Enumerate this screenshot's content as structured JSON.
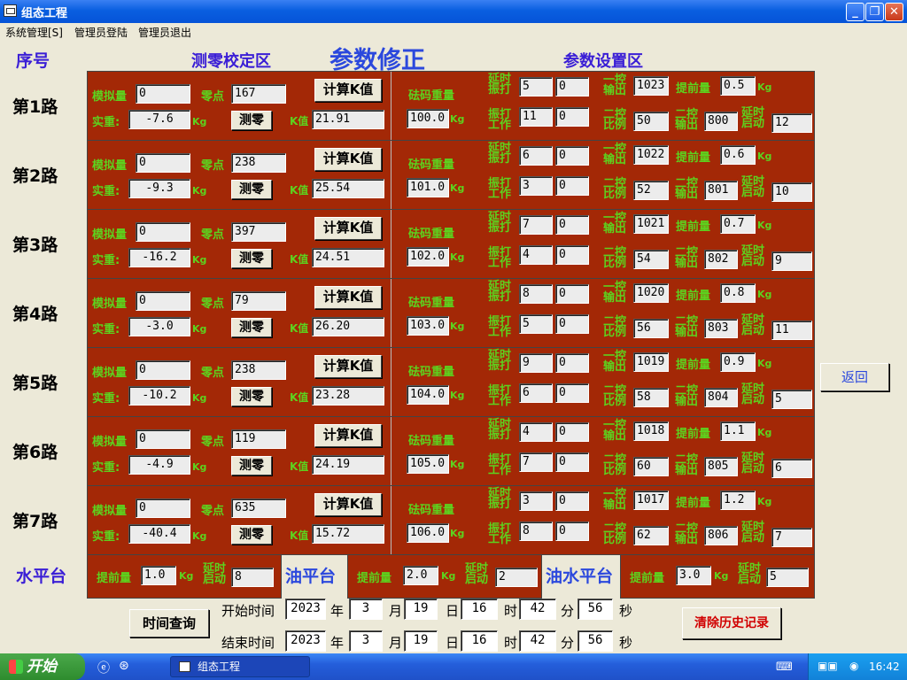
{
  "window": {
    "title": "组态工程"
  },
  "menu": [
    "系统管理[S]",
    "管理员登陆",
    "管理员退出"
  ],
  "header": {
    "seq": "序号",
    "calib": "测零校定区",
    "main": "参数修正",
    "params": "参数设置区"
  },
  "labels": {
    "analog": "模拟量",
    "zero": "零点",
    "weight": "实重:",
    "calc_k": "计算K值",
    "tare": "测零",
    "k_value": "K值",
    "weight_std": "砝码重量",
    "delay_vib_1": "延时",
    "delay_vib_2": "振打",
    "vib_work_1": "振打",
    "vib_work_2": "工作",
    "ctrl1_out_1": "一控",
    "ctrl1_out_2": "输出",
    "advance": "提前量",
    "ctrl2_ratio_1": "二控",
    "ctrl2_ratio_2": "比例",
    "ctrl2_out_1": "二控",
    "ctrl2_out_2": "输出",
    "delay_start_1": "延时",
    "delay_start_2": "启动",
    "kg": "Kg"
  },
  "rows": [
    {
      "name": "第1路",
      "analog": "0",
      "zero": "167",
      "weight": "-7.6",
      "k": "21.91",
      "std": "100.0",
      "dv1": "5",
      "dv2": "0",
      "vw1": "11",
      "vw2": "0",
      "c1out": "1023",
      "adv": "0.5",
      "c2ratio": "50",
      "c2out": "800",
      "dstart": "12"
    },
    {
      "name": "第2路",
      "analog": "0",
      "zero": "238",
      "weight": "-9.3",
      "k": "25.54",
      "std": "101.0",
      "dv1": "6",
      "dv2": "0",
      "vw1": "3",
      "vw2": "0",
      "c1out": "1022",
      "adv": "0.6",
      "c2ratio": "52",
      "c2out": "801",
      "dstart": "10"
    },
    {
      "name": "第3路",
      "analog": "0",
      "zero": "397",
      "weight": "-16.2",
      "k": "24.51",
      "std": "102.0",
      "dv1": "7",
      "dv2": "0",
      "vw1": "4",
      "vw2": "0",
      "c1out": "1021",
      "adv": "0.7",
      "c2ratio": "54",
      "c2out": "802",
      "dstart": "9"
    },
    {
      "name": "第4路",
      "analog": "0",
      "zero": "79",
      "weight": "-3.0",
      "k": "26.20",
      "std": "103.0",
      "dv1": "8",
      "dv2": "0",
      "vw1": "5",
      "vw2": "0",
      "c1out": "1020",
      "adv": "0.8",
      "c2ratio": "56",
      "c2out": "803",
      "dstart": "11"
    },
    {
      "name": "第5路",
      "analog": "0",
      "zero": "238",
      "weight": "-10.2",
      "k": "23.28",
      "std": "104.0",
      "dv1": "9",
      "dv2": "0",
      "vw1": "6",
      "vw2": "0",
      "c1out": "1019",
      "adv": "0.9",
      "c2ratio": "58",
      "c2out": "804",
      "dstart": "5"
    },
    {
      "name": "第6路",
      "analog": "0",
      "zero": "119",
      "weight": "-4.9",
      "k": "24.19",
      "std": "105.0",
      "dv1": "4",
      "dv2": "0",
      "vw1": "7",
      "vw2": "0",
      "c1out": "1018",
      "adv": "1.1",
      "c2ratio": "60",
      "c2out": "805",
      "dstart": "6"
    },
    {
      "name": "第7路",
      "analog": "0",
      "zero": "635",
      "weight": "-40.4",
      "k": "15.72",
      "std": "106.0",
      "dv1": "3",
      "dv2": "0",
      "vw1": "8",
      "vw2": "0",
      "c1out": "1017",
      "adv": "1.2",
      "c2ratio": "62",
      "c2out": "806",
      "dstart": "7"
    }
  ],
  "platforms": {
    "water": {
      "name": "水平台",
      "adv_label": "提前量",
      "adv": "1.0",
      "delay_label_1": "延时",
      "delay_label_2": "启动",
      "delay": "8"
    },
    "oil": {
      "name": "油平台",
      "adv_label": "提前量",
      "adv": "2.0",
      "delay_label_1": "延时",
      "delay_label_2": "启动",
      "delay": "2"
    },
    "oilwater": {
      "name": "油水平台",
      "adv_label": "提前量",
      "adv": "3.0",
      "delay_label_1": "延时",
      "delay_label_2": "启动",
      "delay": "5"
    }
  },
  "time_query": {
    "button": "时间查询",
    "start_label": "开始时间",
    "end_label": "结束时间",
    "start": {
      "year": "2023",
      "month": "3",
      "day": "19",
      "hour": "16",
      "minute": "42",
      "second": "56"
    },
    "end": {
      "year": "2023",
      "month": "3",
      "day": "19",
      "hour": "16",
      "minute": "42",
      "second": "56"
    },
    "units": {
      "year": "年",
      "month": "月",
      "day": "日",
      "hour": "时",
      "minute": "分",
      "second": "秒"
    }
  },
  "buttons": {
    "back": "返回",
    "clear_history": "清除历史记录"
  },
  "taskbar": {
    "start": "开始",
    "item": "组态工程",
    "clock": "16:42"
  },
  "colors": {
    "panel": "#a32806",
    "label_green": "#5dd21e",
    "title_blue": "#3a1ed6",
    "clear_red": "#d10000"
  }
}
